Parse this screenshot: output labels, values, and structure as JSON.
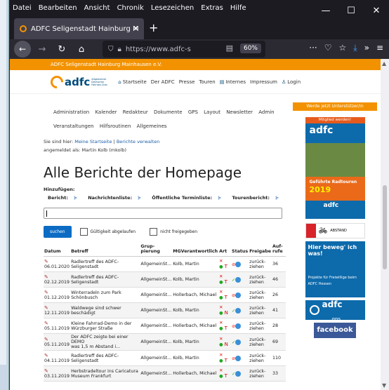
{
  "browser": {
    "menu": [
      "Datei",
      "Bearbeiten",
      "Ansicht",
      "Chronik",
      "Lesezeichen",
      "Extras",
      "Hilfe"
    ],
    "tab_title": "ADFC Seligenstadt Hainburg M",
    "url": "https://www.adfc-s",
    "zoom": "60%"
  },
  "site": {
    "top_bar": "ADFC Seligenstadt Hainburg Mainhausen e.V.",
    "logo_word": "adfc",
    "logo_sub": "Allgemeiner Deutscher Fahrrad-Club",
    "nav": [
      "Startseite",
      "Der ADFC",
      "Presse",
      "Touren",
      "Internes",
      "Impressum",
      "Login"
    ]
  },
  "submenu": [
    "Administration",
    "Kalender",
    "Redakteur",
    "Dokumente",
    "GPS",
    "Layout",
    "Newsletter",
    "Admin",
    "Veranstaltungen",
    "Hilfsroutinen",
    "Allgemeines"
  ],
  "breadcrumb": {
    "prefix": "Sie sind hier:",
    "home": "Meine Startseite",
    "sep": "|",
    "current": "Berichte verwalten"
  },
  "logged_in": "angemeldet als: Martin Kolb (mkolb)",
  "heading": "Alle Berichte der Homepage",
  "add": {
    "label": "Hinzufügen:",
    "items": [
      "Bericht:",
      "Nachrichtenliste:",
      "Öffentliche Terminliste:",
      "Tourenbericht:"
    ]
  },
  "search": {
    "button": "suchen",
    "check1": "Gültigkeit abgelaufen",
    "check2": "nicht freigegeben"
  },
  "table": {
    "headers": [
      "Datum",
      "Betreff",
      "Grup-pierung",
      "MGVerantwortlich",
      "Art",
      "Status",
      "Freigabe",
      "Auf-rufe"
    ],
    "rows": [
      {
        "date": "06.01.2020",
        "subject1": "Radlertreff des ADFC-",
        "subject2": "Seligenstadt",
        "group": "AllgemeinSt...",
        "resp": "Kolb, Martin",
        "art": "T",
        "release": "zurück-ziehen",
        "views": "36"
      },
      {
        "date": "02.12.2019",
        "subject1": "Radlertreff des ADFC-",
        "subject2": "Seligenstadt",
        "group": "AllgemeinSt...",
        "resp": "Kolb, Martin",
        "art": "T",
        "release": "zurück-ziehen",
        "views": "46"
      },
      {
        "date": "01.12.2019",
        "subject1": "Winterradeln zum Park",
        "subject2": "Schönbusch",
        "group": "AllgemeinSt...",
        "resp": "Hollerbach, Michael",
        "art": "T",
        "release": "zurück-ziehen",
        "views": "26"
      },
      {
        "date": "12.11.2019",
        "subject1": "Waldwege sind schwer",
        "subject2": "beschädigt",
        "group": "AllgemeinSt...",
        "resp": "Kolb, Martin",
        "art": "N",
        "release": "zurück-ziehen",
        "views": "41"
      },
      {
        "date": "05.11.2019",
        "subject1": "Kleine Fahrrad-Demo in der",
        "subject2": "Würzburger Straße",
        "group": "AllgemeinSt...",
        "resp": "Hollerbach, Michael",
        "art": "T",
        "release": "zurück-ziehen",
        "views": "28"
      },
      {
        "date": "05.11.2019",
        "subject1": "Der ADFC zeigte bei einer DEMO",
        "subject2": "was 1,5 m Abstand i...",
        "group": "AllgemeinSt...",
        "resp": "Kolb, Martin",
        "art": "N",
        "release": "zurück-ziehen",
        "views": "69"
      },
      {
        "date": "04.11.2019",
        "subject1": "Radlertreff des ADFC-",
        "subject2": "Seligenstadt",
        "group": "AllgemeinSt...",
        "resp": "Kolb, Martin",
        "art": "T",
        "release": "zurück-ziehen",
        "views": "110"
      },
      {
        "date": "03.11.2019",
        "subject1": "Herbstradeltour ins Caricatura",
        "subject2": "Museum Frankfurt",
        "group": "AllgemeinSt...",
        "resp": "Hollerbach, Michael",
        "art": "T",
        "release": "zurück-ziehen",
        "views": "33"
      }
    ]
  },
  "sidebar": {
    "header": "Werde jetzt Unterstützer/in",
    "ad1_top": "Mitglied werden!",
    "ad1_logo": "adfc",
    "ad1_tours": "Geführte Radtouren",
    "ad1_year": "2019",
    "ad1_bottom": "adfc",
    "ad2": "ABSTAND",
    "ad3_title": "Hier beweg' ich was!",
    "ad3_text": "Projekte für Freiwillige beim ADFC Hessen",
    "ad4_word": "adfc",
    "ad4_gps": "gps",
    "ad5": "facebook"
  }
}
